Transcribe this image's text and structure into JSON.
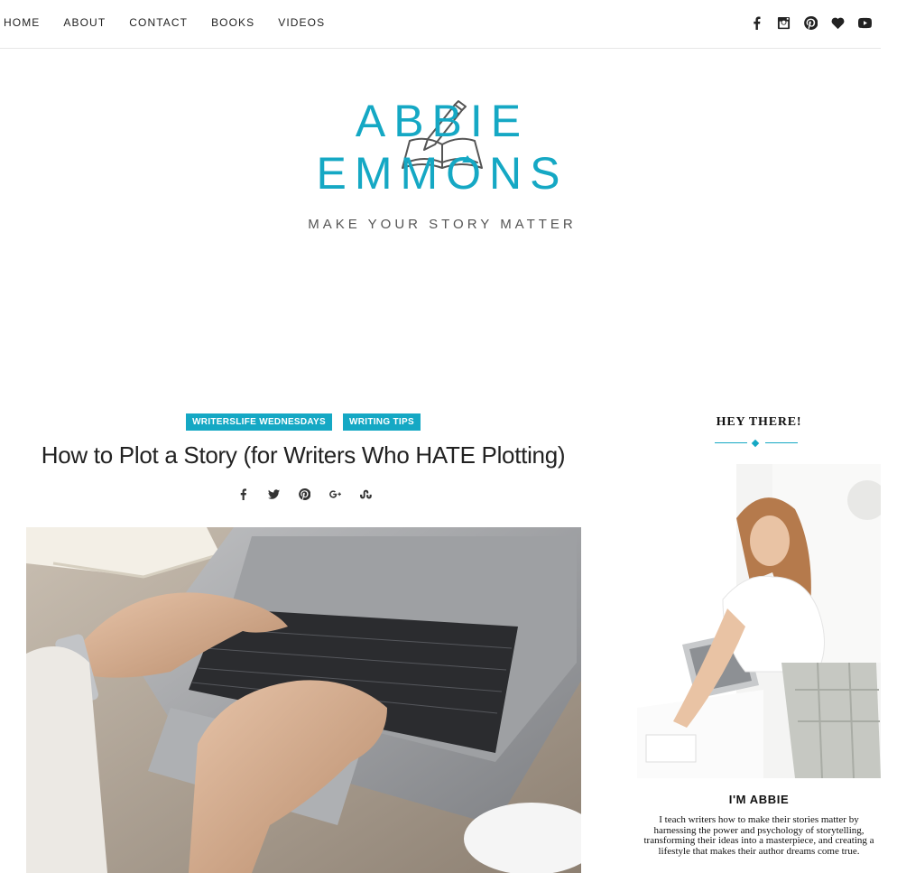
{
  "nav": {
    "links": [
      "HOME",
      "ABOUT",
      "CONTACT",
      "BOOKS",
      "VIDEOS"
    ],
    "social_icons": [
      "facebook-icon",
      "instagram-icon",
      "pinterest-icon",
      "heart-icon",
      "youtube-icon"
    ]
  },
  "brand": {
    "name_line1": "ABBIE",
    "name_line2": "EMMONS",
    "tagline": "MAKE YOUR STORY MATTER",
    "accent": "#15a8c4"
  },
  "post": {
    "categories": [
      "WRITERSLIFE WEDNESDAYS",
      "WRITING TIPS"
    ],
    "title": "How to Plot a Story (for Writers Who HATE Plotting)",
    "share_icons": [
      "facebook-icon",
      "twitter-icon",
      "pinterest-icon",
      "google-plus-icon",
      "stumbleupon-icon"
    ]
  },
  "sidebar": {
    "heading": "HEY THERE!",
    "name": "I'M ABBIE",
    "bio": "I teach writers how to make their stories matter by harnessing the power and psychology of storytelling, transforming their ideas into a masterpiece, and creating a lifestyle that makes their author dreams come true."
  }
}
